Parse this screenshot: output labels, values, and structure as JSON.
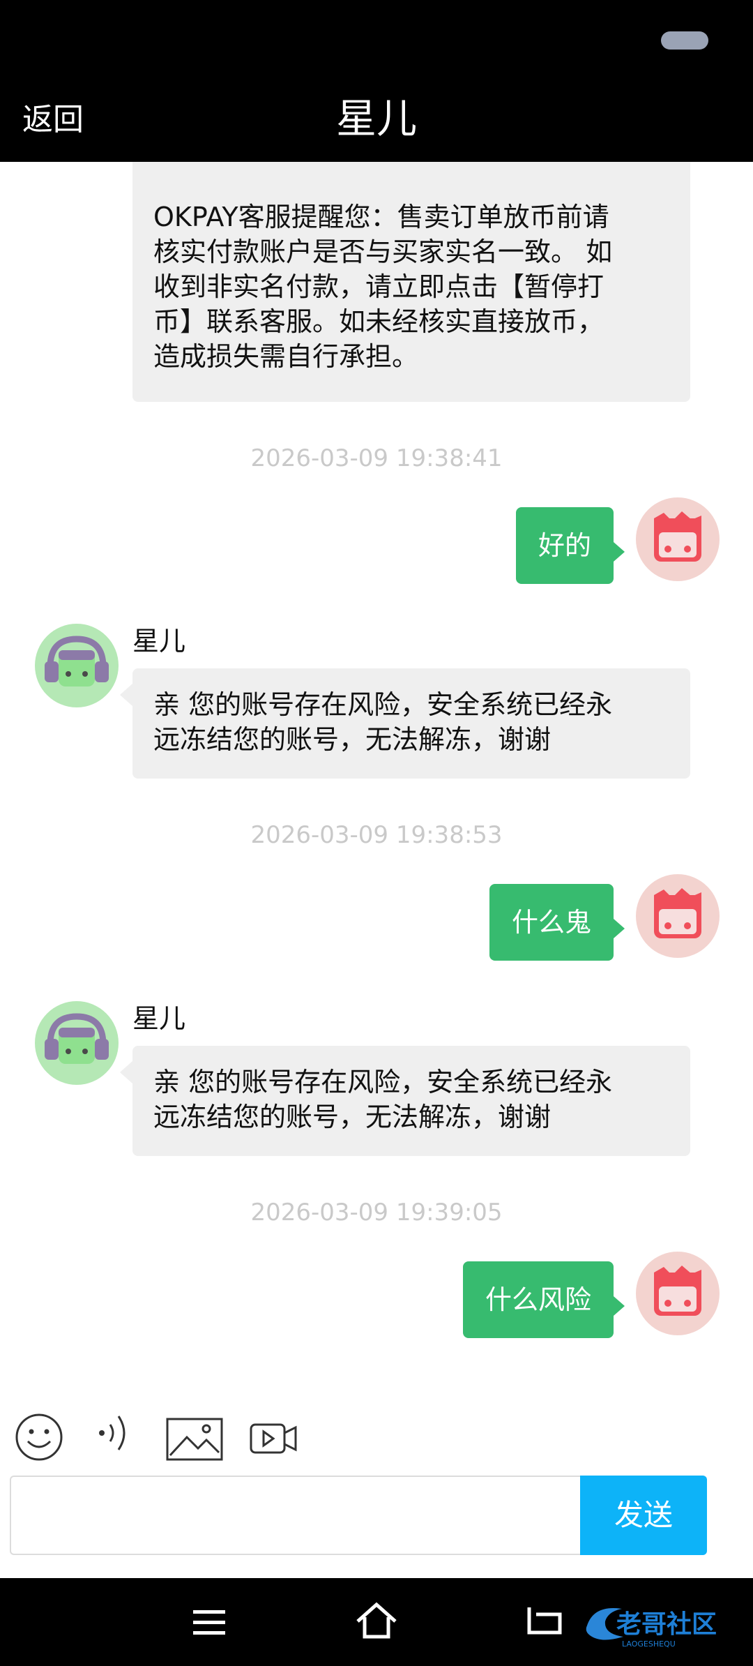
{
  "header": {
    "back_label": "返回",
    "title": "星儿"
  },
  "messages": [
    {
      "type": "incoming",
      "text_lines": [
        "OKPAY客服提醒您：售卖订单放币前请",
        "核实付款账户是否与买家实名一致。 如",
        "收到非实名付款，请立即点击【暂停打",
        "币】联系客服。如未经核实直接放币，",
        "造成损失需自行承担。"
      ]
    },
    {
      "type": "timestamp",
      "text": "2026-03-09 19:38:41"
    },
    {
      "type": "outgoing",
      "text": "好的"
    },
    {
      "type": "incoming",
      "sender": "星儿",
      "text_lines": [
        "亲 您的账号存在风险，安全系统已经永",
        "远冻结您的账号，无法解冻，谢谢"
      ]
    },
    {
      "type": "timestamp",
      "text": "2026-03-09 19:38:53"
    },
    {
      "type": "outgoing",
      "text": "什么鬼"
    },
    {
      "type": "incoming",
      "sender": "星儿",
      "text_lines": [
        "亲 您的账号存在风险，安全系统已经永",
        "远冻结您的账号，无法解冻，谢谢"
      ]
    },
    {
      "type": "timestamp",
      "text": "2026-03-09 19:39:05"
    },
    {
      "type": "outgoing",
      "text": "什么风险"
    }
  ],
  "toolbar": {
    "icons": [
      "emoji-icon",
      "voice-icon",
      "image-icon",
      "video-icon"
    ]
  },
  "composer": {
    "input_value": "",
    "send_label": "发送"
  },
  "watermark": {
    "text": "老哥社区",
    "subtext": "LAOGESHEQU"
  },
  "colors": {
    "outgoing_bubble": "#37bb6f",
    "incoming_bubble": "#efefef",
    "send_button": "#0db3f8",
    "header_bg": "#000000"
  }
}
